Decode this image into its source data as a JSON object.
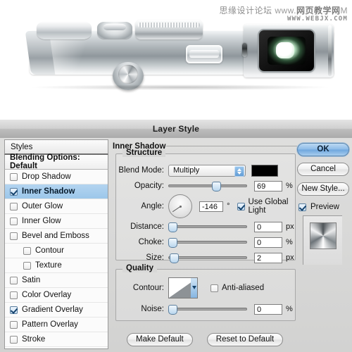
{
  "watermark": {
    "line1_cn": "思缘设计论坛",
    "line1_www": "www.",
    "line1_cn2": "网页教学网",
    "line1_suffix": "M",
    "line2": "WWW.WEBJX.COM"
  },
  "photo": {
    "alt_name": "camera-body-render"
  },
  "dialog": {
    "title": "Layer Style",
    "styles_panel": {
      "header": "Styles",
      "blending_options": "Blending Options: Default",
      "items": [
        {
          "label": "Drop Shadow",
          "checked": false,
          "selected": false,
          "indent": false
        },
        {
          "label": "Inner Shadow",
          "checked": true,
          "selected": true,
          "indent": false
        },
        {
          "label": "Outer Glow",
          "checked": false,
          "selected": false,
          "indent": false
        },
        {
          "label": "Inner Glow",
          "checked": false,
          "selected": false,
          "indent": false
        },
        {
          "label": "Bevel and Emboss",
          "checked": false,
          "selected": false,
          "indent": false
        },
        {
          "label": "Contour",
          "checked": false,
          "selected": false,
          "indent": true
        },
        {
          "label": "Texture",
          "checked": false,
          "selected": false,
          "indent": true
        },
        {
          "label": "Satin",
          "checked": false,
          "selected": false,
          "indent": false
        },
        {
          "label": "Color Overlay",
          "checked": false,
          "selected": false,
          "indent": false
        },
        {
          "label": "Gradient Overlay",
          "checked": true,
          "selected": false,
          "indent": false
        },
        {
          "label": "Pattern Overlay",
          "checked": false,
          "selected": false,
          "indent": false
        },
        {
          "label": "Stroke",
          "checked": false,
          "selected": false,
          "indent": false
        }
      ]
    },
    "section_title": "Inner Shadow",
    "structure": {
      "legend": "Structure",
      "blend_mode_label": "Blend Mode:",
      "blend_mode_value": "Multiply",
      "blend_color": "#000000",
      "opacity_label": "Opacity:",
      "opacity_value": "69",
      "opacity_unit": "%",
      "angle_label": "Angle:",
      "angle_value": "-146",
      "angle_unit": "°",
      "use_global_light": "Use Global Light",
      "use_global_light_checked": true,
      "distance_label": "Distance:",
      "distance_value": "0",
      "distance_unit": "px",
      "choke_label": "Choke:",
      "choke_value": "0",
      "choke_unit": "%",
      "size_label": "Size:",
      "size_value": "2",
      "size_unit": "px"
    },
    "quality": {
      "legend": "Quality",
      "contour_label": "Contour:",
      "anti_aliased": "Anti-aliased",
      "anti_aliased_checked": false,
      "noise_label": "Noise:",
      "noise_value": "0",
      "noise_unit": "%"
    },
    "defaults": {
      "make_default": "Make Default",
      "reset_to_default": "Reset to Default"
    },
    "buttons": {
      "ok": "OK",
      "cancel": "Cancel",
      "new_style": "New Style...",
      "preview": "Preview",
      "preview_checked": true
    },
    "accent_color": "#6fa7de",
    "selection_color": "#a6cdec"
  }
}
